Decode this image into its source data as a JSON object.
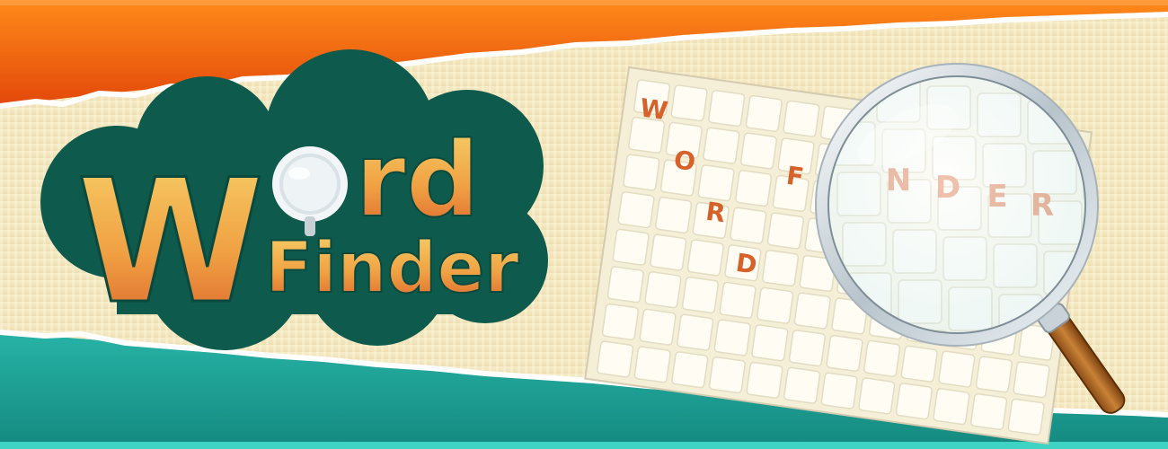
{
  "logo": {
    "line1_first": "W",
    "line1_rest": "rd",
    "line2": "Finder"
  },
  "grid": {
    "outside_letters": [
      "W",
      "O",
      "R",
      "D",
      "F"
    ],
    "lens_letters": [
      "N",
      "D",
      "E",
      "R"
    ]
  },
  "colors": {
    "top_stripe": "#f05e0a",
    "bottom_stripe": "#1fa098",
    "paper": "#f3e6bd",
    "logo_badge": "#0e5a4c",
    "letter_orange": "#d6622a"
  }
}
